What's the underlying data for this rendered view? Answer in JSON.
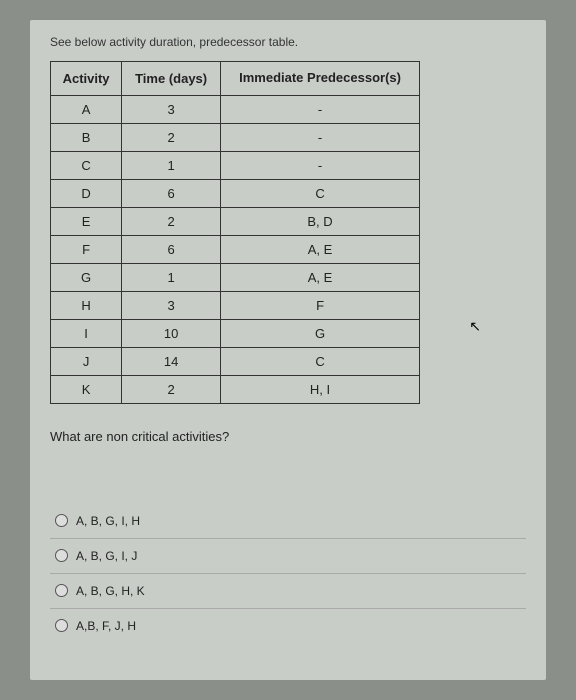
{
  "intro": "See below activity duration, predecessor table.",
  "table": {
    "headers": {
      "activity": "Activity",
      "time": "Time (days)",
      "predecessor": "Immediate Predecessor(s)"
    },
    "rows": [
      {
        "activity": "A",
        "time": "3",
        "pred": "-"
      },
      {
        "activity": "B",
        "time": "2",
        "pred": "-"
      },
      {
        "activity": "C",
        "time": "1",
        "pred": "-"
      },
      {
        "activity": "D",
        "time": "6",
        "pred": "C"
      },
      {
        "activity": "E",
        "time": "2",
        "pred": "B, D"
      },
      {
        "activity": "F",
        "time": "6",
        "pred": "A, E"
      },
      {
        "activity": "G",
        "time": "1",
        "pred": "A, E"
      },
      {
        "activity": "H",
        "time": "3",
        "pred": "F"
      },
      {
        "activity": "I",
        "time": "10",
        "pred": "G"
      },
      {
        "activity": "J",
        "time": "14",
        "pred": "C"
      },
      {
        "activity": "K",
        "time": "2",
        "pred": "H, I"
      }
    ]
  },
  "question": "What are non critical activities?",
  "options": [
    {
      "label": "A, B, G, I, H"
    },
    {
      "label": "A, B, G, I, J"
    },
    {
      "label": "A, B, G, H, K"
    },
    {
      "label": "A,B, F, J, H"
    }
  ]
}
